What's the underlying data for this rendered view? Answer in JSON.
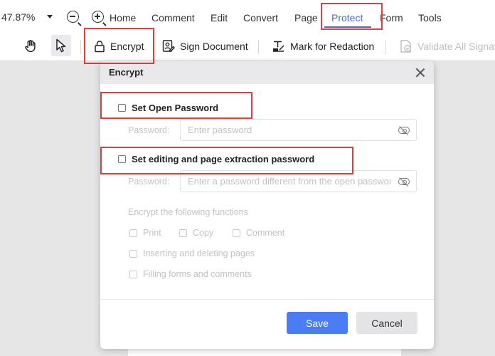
{
  "menubar": {
    "zoom_value": "47.87%",
    "items": [
      {
        "label": "Home"
      },
      {
        "label": "Comment"
      },
      {
        "label": "Edit"
      },
      {
        "label": "Convert"
      },
      {
        "label": "Page"
      },
      {
        "label": "Protect"
      },
      {
        "label": "Form"
      },
      {
        "label": "Tools"
      }
    ],
    "active_item": "Protect",
    "accent_color": "#3f6bf0"
  },
  "toolbar": {
    "encrypt_label": "Encrypt",
    "sign_label": "Sign Document",
    "redaction_label": "Mark for Redaction",
    "validate_label": "Validate All Signatures"
  },
  "dialog": {
    "title": "Encrypt",
    "open_password": {
      "checkbox_label": "Set Open Password",
      "field_label": "Password:",
      "placeholder": "Enter password",
      "value": ""
    },
    "editing_password": {
      "checkbox_label": "Set editing and page extraction password",
      "field_label": "Password:",
      "placeholder": "Enter a password different from the open password",
      "value": ""
    },
    "functions_label": "Encrypt the following functions",
    "functions": {
      "print": "Print",
      "copy": "Copy",
      "comment": "Comment",
      "inserting": "Inserting and deleting pages",
      "filling": "Filling forms and comments"
    },
    "save_label": "Save",
    "cancel_label": "Cancel",
    "save_color": "#4a7cf3"
  },
  "highlight_color": "#e23b3b"
}
